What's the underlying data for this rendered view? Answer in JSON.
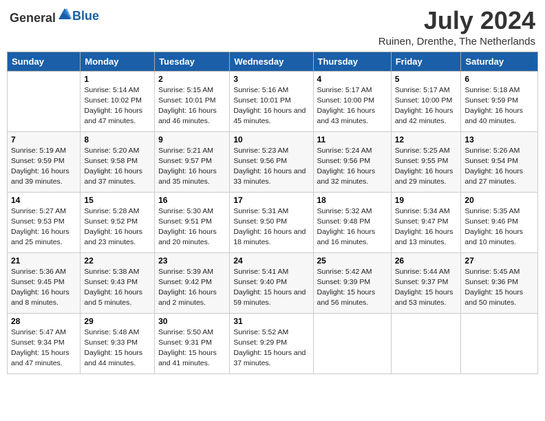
{
  "header": {
    "logo_general": "General",
    "logo_blue": "Blue",
    "title": "July 2024",
    "location": "Ruinen, Drenthe, The Netherlands"
  },
  "days_of_week": [
    "Sunday",
    "Monday",
    "Tuesday",
    "Wednesday",
    "Thursday",
    "Friday",
    "Saturday"
  ],
  "weeks": [
    [
      {
        "day": "",
        "sunrise": "",
        "sunset": "",
        "daylight": ""
      },
      {
        "day": "1",
        "sunrise": "Sunrise: 5:14 AM",
        "sunset": "Sunset: 10:02 PM",
        "daylight": "Daylight: 16 hours and 47 minutes."
      },
      {
        "day": "2",
        "sunrise": "Sunrise: 5:15 AM",
        "sunset": "Sunset: 10:01 PM",
        "daylight": "Daylight: 16 hours and 46 minutes."
      },
      {
        "day": "3",
        "sunrise": "Sunrise: 5:16 AM",
        "sunset": "Sunset: 10:01 PM",
        "daylight": "Daylight: 16 hours and 45 minutes."
      },
      {
        "day": "4",
        "sunrise": "Sunrise: 5:17 AM",
        "sunset": "Sunset: 10:00 PM",
        "daylight": "Daylight: 16 hours and 43 minutes."
      },
      {
        "day": "5",
        "sunrise": "Sunrise: 5:17 AM",
        "sunset": "Sunset: 10:00 PM",
        "daylight": "Daylight: 16 hours and 42 minutes."
      },
      {
        "day": "6",
        "sunrise": "Sunrise: 5:18 AM",
        "sunset": "Sunset: 9:59 PM",
        "daylight": "Daylight: 16 hours and 40 minutes."
      }
    ],
    [
      {
        "day": "7",
        "sunrise": "Sunrise: 5:19 AM",
        "sunset": "Sunset: 9:59 PM",
        "daylight": "Daylight: 16 hours and 39 minutes."
      },
      {
        "day": "8",
        "sunrise": "Sunrise: 5:20 AM",
        "sunset": "Sunset: 9:58 PM",
        "daylight": "Daylight: 16 hours and 37 minutes."
      },
      {
        "day": "9",
        "sunrise": "Sunrise: 5:21 AM",
        "sunset": "Sunset: 9:57 PM",
        "daylight": "Daylight: 16 hours and 35 minutes."
      },
      {
        "day": "10",
        "sunrise": "Sunrise: 5:23 AM",
        "sunset": "Sunset: 9:56 PM",
        "daylight": "Daylight: 16 hours and 33 minutes."
      },
      {
        "day": "11",
        "sunrise": "Sunrise: 5:24 AM",
        "sunset": "Sunset: 9:56 PM",
        "daylight": "Daylight: 16 hours and 32 minutes."
      },
      {
        "day": "12",
        "sunrise": "Sunrise: 5:25 AM",
        "sunset": "Sunset: 9:55 PM",
        "daylight": "Daylight: 16 hours and 29 minutes."
      },
      {
        "day": "13",
        "sunrise": "Sunrise: 5:26 AM",
        "sunset": "Sunset: 9:54 PM",
        "daylight": "Daylight: 16 hours and 27 minutes."
      }
    ],
    [
      {
        "day": "14",
        "sunrise": "Sunrise: 5:27 AM",
        "sunset": "Sunset: 9:53 PM",
        "daylight": "Daylight: 16 hours and 25 minutes."
      },
      {
        "day": "15",
        "sunrise": "Sunrise: 5:28 AM",
        "sunset": "Sunset: 9:52 PM",
        "daylight": "Daylight: 16 hours and 23 minutes."
      },
      {
        "day": "16",
        "sunrise": "Sunrise: 5:30 AM",
        "sunset": "Sunset: 9:51 PM",
        "daylight": "Daylight: 16 hours and 20 minutes."
      },
      {
        "day": "17",
        "sunrise": "Sunrise: 5:31 AM",
        "sunset": "Sunset: 9:50 PM",
        "daylight": "Daylight: 16 hours and 18 minutes."
      },
      {
        "day": "18",
        "sunrise": "Sunrise: 5:32 AM",
        "sunset": "Sunset: 9:48 PM",
        "daylight": "Daylight: 16 hours and 16 minutes."
      },
      {
        "day": "19",
        "sunrise": "Sunrise: 5:34 AM",
        "sunset": "Sunset: 9:47 PM",
        "daylight": "Daylight: 16 hours and 13 minutes."
      },
      {
        "day": "20",
        "sunrise": "Sunrise: 5:35 AM",
        "sunset": "Sunset: 9:46 PM",
        "daylight": "Daylight: 16 hours and 10 minutes."
      }
    ],
    [
      {
        "day": "21",
        "sunrise": "Sunrise: 5:36 AM",
        "sunset": "Sunset: 9:45 PM",
        "daylight": "Daylight: 16 hours and 8 minutes."
      },
      {
        "day": "22",
        "sunrise": "Sunrise: 5:38 AM",
        "sunset": "Sunset: 9:43 PM",
        "daylight": "Daylight: 16 hours and 5 minutes."
      },
      {
        "day": "23",
        "sunrise": "Sunrise: 5:39 AM",
        "sunset": "Sunset: 9:42 PM",
        "daylight": "Daylight: 16 hours and 2 minutes."
      },
      {
        "day": "24",
        "sunrise": "Sunrise: 5:41 AM",
        "sunset": "Sunset: 9:40 PM",
        "daylight": "Daylight: 15 hours and 59 minutes."
      },
      {
        "day": "25",
        "sunrise": "Sunrise: 5:42 AM",
        "sunset": "Sunset: 9:39 PM",
        "daylight": "Daylight: 15 hours and 56 minutes."
      },
      {
        "day": "26",
        "sunrise": "Sunrise: 5:44 AM",
        "sunset": "Sunset: 9:37 PM",
        "daylight": "Daylight: 15 hours and 53 minutes."
      },
      {
        "day": "27",
        "sunrise": "Sunrise: 5:45 AM",
        "sunset": "Sunset: 9:36 PM",
        "daylight": "Daylight: 15 hours and 50 minutes."
      }
    ],
    [
      {
        "day": "28",
        "sunrise": "Sunrise: 5:47 AM",
        "sunset": "Sunset: 9:34 PM",
        "daylight": "Daylight: 15 hours and 47 minutes."
      },
      {
        "day": "29",
        "sunrise": "Sunrise: 5:48 AM",
        "sunset": "Sunset: 9:33 PM",
        "daylight": "Daylight: 15 hours and 44 minutes."
      },
      {
        "day": "30",
        "sunrise": "Sunrise: 5:50 AM",
        "sunset": "Sunset: 9:31 PM",
        "daylight": "Daylight: 15 hours and 41 minutes."
      },
      {
        "day": "31",
        "sunrise": "Sunrise: 5:52 AM",
        "sunset": "Sunset: 9:29 PM",
        "daylight": "Daylight: 15 hours and 37 minutes."
      },
      {
        "day": "",
        "sunrise": "",
        "sunset": "",
        "daylight": ""
      },
      {
        "day": "",
        "sunrise": "",
        "sunset": "",
        "daylight": ""
      },
      {
        "day": "",
        "sunrise": "",
        "sunset": "",
        "daylight": ""
      }
    ]
  ]
}
